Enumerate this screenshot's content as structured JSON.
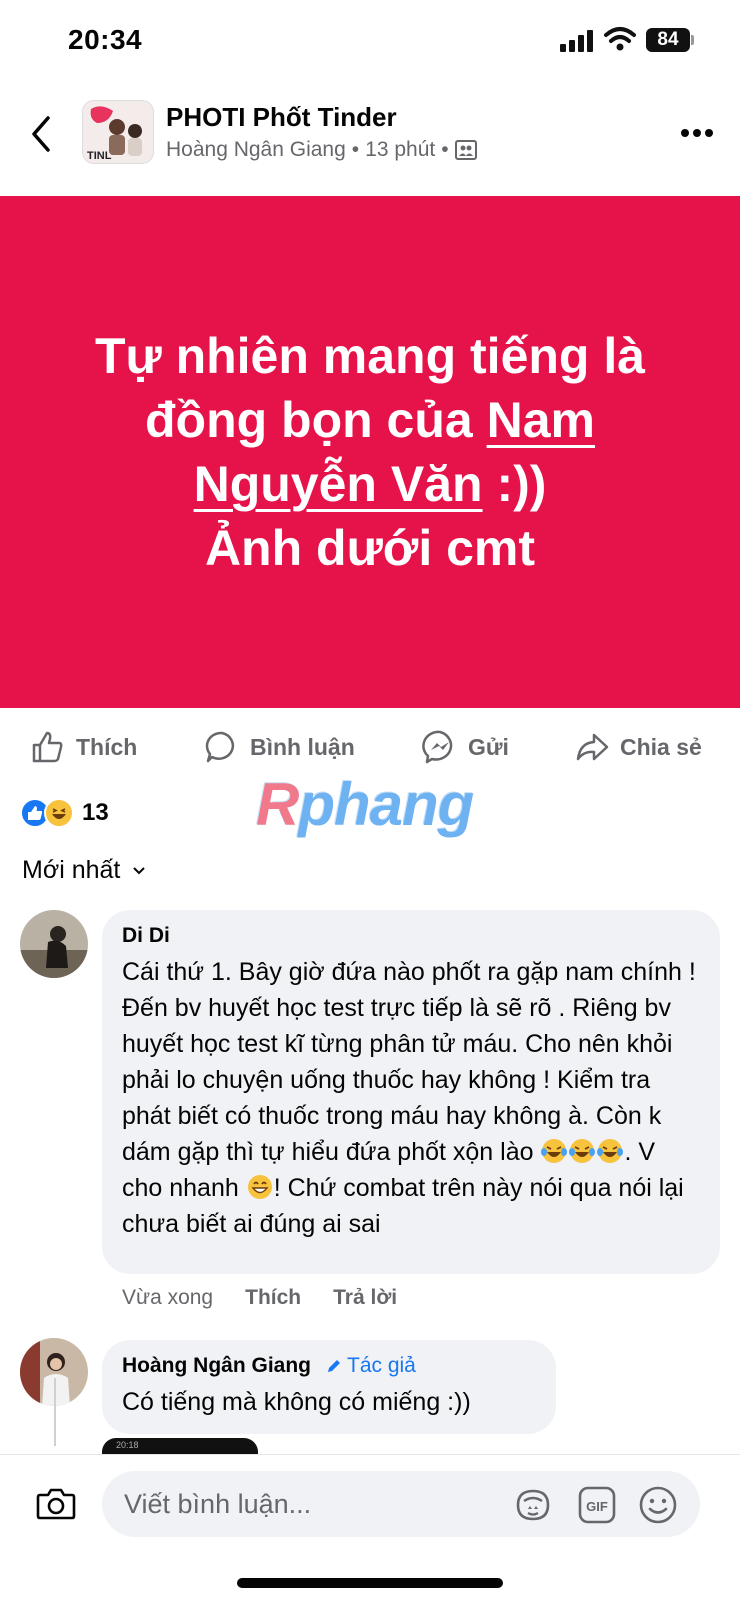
{
  "status_bar": {
    "time": "20:34",
    "battery": "84"
  },
  "post": {
    "group_name": "PHOTI Phốt Tinder",
    "author": "Hoàng Ngân Giang",
    "time_ago": "13 phút",
    "avatar_text": "TINL",
    "banner_color": "#e5134a",
    "banner": {
      "line1": "Tự nhiên mang tiếng là",
      "line2_prefix": "đồng bọn của ",
      "line2_link": "Nam",
      "line3_link": "Nguyễn Văn",
      "line3_suffix": " :))",
      "line4": "Ảnh dưới cmt"
    }
  },
  "actions": {
    "like": "Thích",
    "comment": "Bình luận",
    "send": "Gửi",
    "share": "Chia sẻ"
  },
  "reactions": {
    "count": "13"
  },
  "watermark": {
    "first": "R",
    "rest": "phang"
  },
  "sort": {
    "label": "Mới nhất"
  },
  "comments": [
    {
      "author": "Di Di",
      "text_a": "Cái thứ 1. Bây giờ đứa nào phốt ra gặp nam chính ! Đến bv huyết học test trực tiếp là sẽ rõ . Riêng bv huyết học test kĩ từng phân tử máu. Cho nên khỏi phải lo chuyện uống thuốc hay không ! Kiểm tra phát biết có thuốc trong máu hay không à. Còn k dám gặp thì tự hiểu đứa phốt xộn lào ",
      "text_b": ". V cho nhanh ",
      "text_c": "! Chứ combat trên này nói qua nói lại chưa biết ai đúng ai sai",
      "time": "Vừa xong",
      "like": "Thích",
      "reply": "Trả lời"
    },
    {
      "author": "Hoàng Ngân Giang",
      "badge": "Tác giả",
      "text": "Có tiếng mà không có miếng :))",
      "thumb_time": "20:18"
    }
  ],
  "composer": {
    "placeholder": "Viết bình luận..."
  }
}
